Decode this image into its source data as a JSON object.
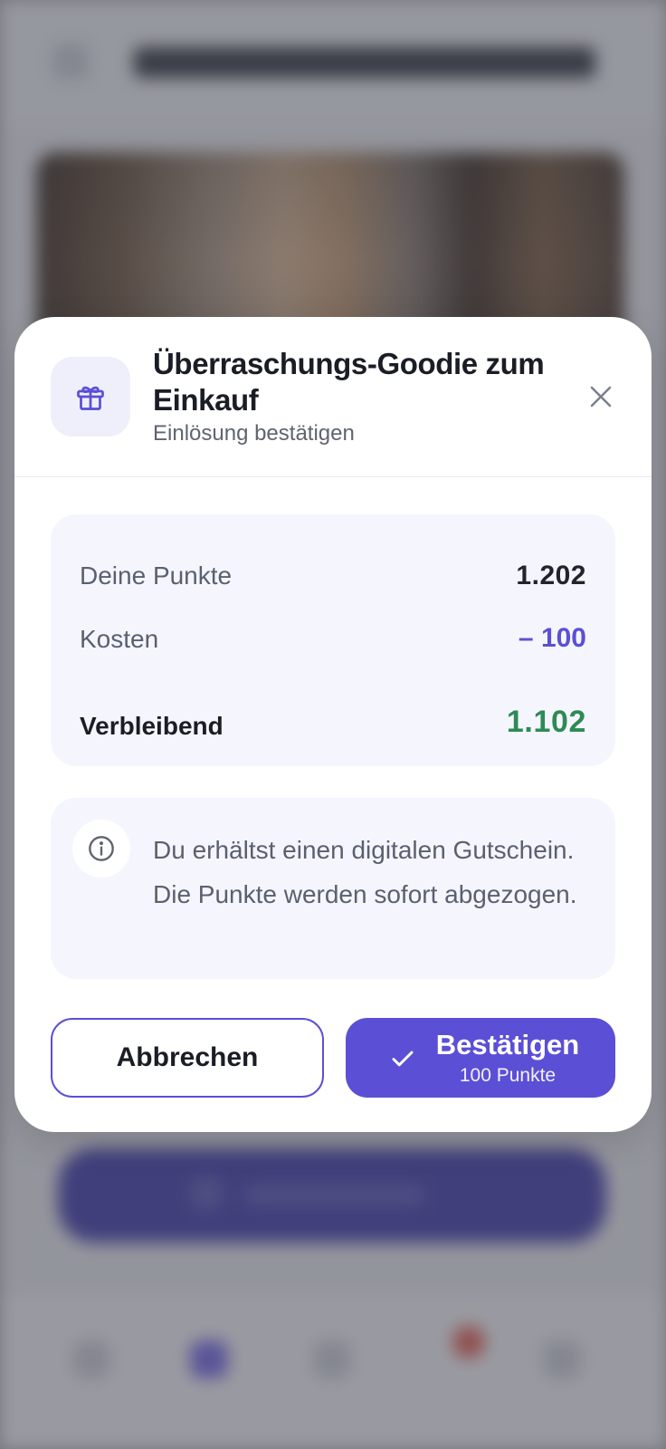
{
  "modal": {
    "title": "Überraschungs-Goodie zum Einkauf",
    "subtitle": "Einlösung bestätigen",
    "icons": {
      "header": "gift-icon",
      "close": "close-icon",
      "info": "info-icon",
      "confirm": "checkmark-icon"
    }
  },
  "points": {
    "balance_label": "Deine Punkte",
    "balance_value": "1.202",
    "cost_label": "Kosten",
    "cost_value": "– 100",
    "remaining_label": "Verbleibend",
    "remaining_value": "1.102"
  },
  "info": {
    "text": "Du erhältst einen digitalen Gutschein. Die Punkte werden sofort abgezogen."
  },
  "actions": {
    "cancel_label": "Abbrechen",
    "confirm_label": "Bestätigen",
    "confirm_sublabel": "100 Punkte"
  },
  "colors": {
    "accent": "#5b4fd6",
    "positive": "#2e8a56",
    "surface": "#f5f6fd",
    "icon_bg": "#efeffc"
  }
}
